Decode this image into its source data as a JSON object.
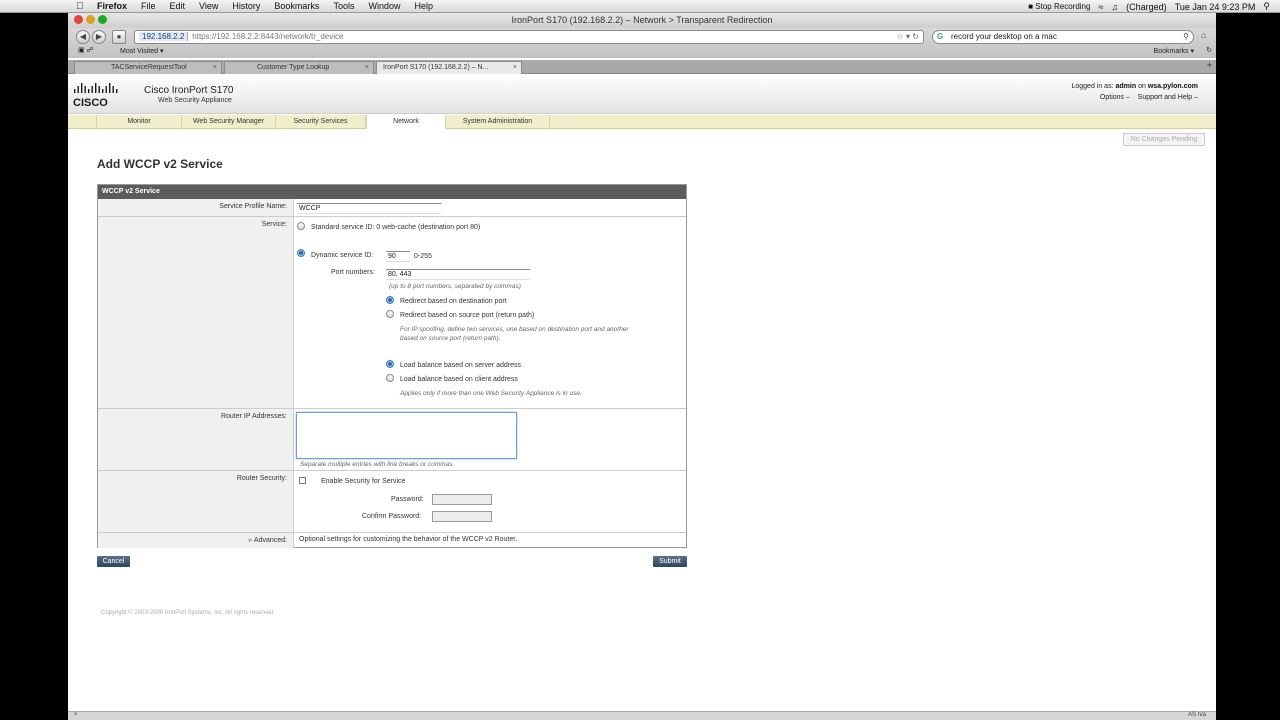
{
  "os_menubar": {
    "app_name": "Firefox",
    "menus": [
      "File",
      "Edit",
      "View",
      "History",
      "Bookmarks",
      "Tools",
      "Window",
      "Help"
    ],
    "recording": "Stop Recording",
    "battery": "(Charged)",
    "clock": "Tue Jan 24  9:23 PM"
  },
  "window": {
    "title": "IronPort S170 (192.168.2.2) – Network > Transparent Redirection"
  },
  "navbar": {
    "url_host": "192.168.2.2",
    "url_rest": "https://192.168.2.2:8443/network/tr_device",
    "search_value": "record your desktop on a mac",
    "most_visited": "Most Visited ▾",
    "bookmarks": "Bookmarks ▾"
  },
  "tabs": [
    {
      "label": "TACServiceRequestTool"
    },
    {
      "label": "Customer Type Lookup"
    },
    {
      "label": "IronPort S170 (192.168.2.2) – N..."
    }
  ],
  "header": {
    "logo_text": "CISCO",
    "product": "Cisco IronPort S170",
    "product_sub": "Web Security Appliance",
    "logged_in_prefix": "Logged in as:",
    "user": "admin",
    "on": "on",
    "host": "wsa.pylon.com",
    "options": "Options",
    "support": "Support and Help"
  },
  "nav_tabs": [
    "Monitor",
    "Web Security Manager",
    "Security Services",
    "Network",
    "System Administration"
  ],
  "pending_button": "No Changes Pending",
  "page_title": "Add WCCP v2 Service",
  "form": {
    "header": "WCCP v2 Service",
    "profile_label": "Service Profile Name:",
    "profile_value": "WCCP",
    "service_label": "Service:",
    "standard_option": "Standard service ID: 0 web-cache (destination port 80)",
    "dynamic_option": "Dynamic service ID:",
    "dynamic_value": "90",
    "dynamic_range": "0-255",
    "ports_label": "Port numbers:",
    "ports_value": "80, 443",
    "ports_hint": "(up to 8 port numbers, separated by commas)",
    "redirect_dest": "Redirect based on destination port",
    "redirect_src": "Redirect based on source port (return path)",
    "spoof_hint_1": "For IP spoofing, define two services, one based on destination port and another",
    "spoof_hint_2": "based on source port (return path).",
    "lb_server": "Load balance based on server address",
    "lb_client": "Load balance based on client address",
    "lb_hint": "Applies only if more than one Web Security Appliance is in use.",
    "router_ip_label": "Router IP Addresses:",
    "router_ip_hint": "Separate multiple entries with line breaks or commas.",
    "security_label": "Router Security:",
    "enable_security": "Enable Security for Service",
    "password_label": "Password:",
    "confirm_label": "Confirm Password:",
    "advanced_label": "▹ Advanced:",
    "advanced_desc": "Optional settings for customizing the behavior of the WCCP v2 Router."
  },
  "buttons": {
    "cancel": "Cancel",
    "submit": "Submit"
  },
  "copyright": "Copyright © 2003-2009 IronPort Systems, Inc. All rights reserved.",
  "statusbar": {
    "right": "AS n/a"
  },
  "colors": {
    "form_header": "#5c5c5c",
    "nav_bg": "#f1eecb",
    "button": "#3b5068"
  }
}
